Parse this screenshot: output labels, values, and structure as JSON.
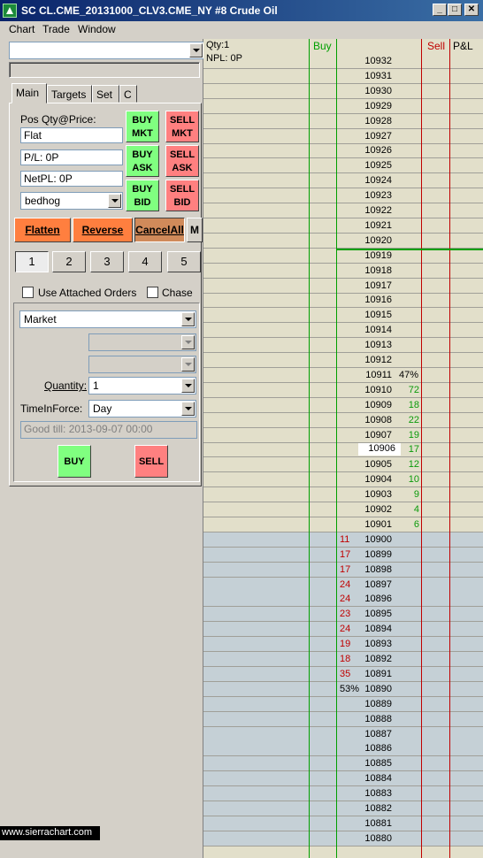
{
  "window": {
    "title": "SC CL.CME_20131000_CLV3.CME_NY  #8  Crude Oil",
    "minimize": "_",
    "maximize": "□",
    "close": "✕"
  },
  "menu": [
    "Chart",
    "Trade",
    "Window"
  ],
  "left": {
    "account_combo": "",
    "tabs": [
      "Main",
      "Targets",
      "Set",
      "C"
    ],
    "pos_label": "Pos Qty@Price:",
    "pos_value": "Flat",
    "pl_value": "P/L: 0P",
    "netpl_value": "NetPL: 0P",
    "account_value": "bedhog",
    "trade_buttons": {
      "buy_mkt": [
        "BUY",
        "MKT"
      ],
      "sell_mkt": [
        "SELL",
        "MKT"
      ],
      "buy_ask": [
        "BUY",
        "ASK"
      ],
      "sell_ask": [
        "SELL",
        "ASK"
      ],
      "buy_bid": [
        "BUY",
        "BID"
      ],
      "sell_bid": [
        "SELL",
        "BID"
      ]
    },
    "flatten": "Flatten",
    "reverse": "Reverse",
    "cancel_all": "CancelAll",
    "m_button": "M",
    "qty_presets": [
      "1",
      "2",
      "3",
      "4",
      "5"
    ],
    "use_attached": "Use Attached Orders",
    "chase": "Chase",
    "order_type": "Market",
    "quantity_label": "Quantity:",
    "quantity_value": "1",
    "tif_label": "TimeInForce:",
    "tif_value": "Day",
    "good_till": "Good till: 2013-09-07 00:00",
    "buy": "BUY",
    "sell": "SELL"
  },
  "ladder": {
    "header": {
      "qty": "Qty:1",
      "npl": "NPL: 0P",
      "buy": "Buy",
      "sell": "Sell",
      "pl": "P&L"
    },
    "colors": {
      "buy": "#00a000",
      "sell": "#c00000",
      "ask_bg": "#e2dfca",
      "bid_bg": "#c5d0d6"
    },
    "current_price": "10906",
    "rows": [
      {
        "price": "10932",
        "ask": "",
        "bid": "",
        "pct": ""
      },
      {
        "price": "10931",
        "ask": "",
        "bid": "",
        "pct": ""
      },
      {
        "price": "10930",
        "ask": "",
        "bid": "",
        "pct": ""
      },
      {
        "price": "10929",
        "ask": "",
        "bid": "",
        "pct": ""
      },
      {
        "price": "10928",
        "ask": "",
        "bid": "",
        "pct": ""
      },
      {
        "price": "10927",
        "ask": "",
        "bid": "",
        "pct": ""
      },
      {
        "price": "10926",
        "ask": "",
        "bid": "",
        "pct": ""
      },
      {
        "price": "10925",
        "ask": "",
        "bid": "",
        "pct": ""
      },
      {
        "price": "10924",
        "ask": "",
        "bid": "",
        "pct": ""
      },
      {
        "price": "10923",
        "ask": "",
        "bid": "",
        "pct": ""
      },
      {
        "price": "10922",
        "ask": "",
        "bid": "",
        "pct": ""
      },
      {
        "price": "10921",
        "ask": "",
        "bid": "",
        "pct": ""
      },
      {
        "price": "10920",
        "ask": "",
        "bid": "",
        "pct": ""
      },
      {
        "price": "10919",
        "ask": "",
        "bid": "",
        "pct": ""
      },
      {
        "price": "10918",
        "ask": "",
        "bid": "",
        "pct": ""
      },
      {
        "price": "10917",
        "ask": "",
        "bid": "",
        "pct": ""
      },
      {
        "price": "10916",
        "ask": "",
        "bid": "",
        "pct": ""
      },
      {
        "price": "10915",
        "ask": "",
        "bid": "",
        "pct": ""
      },
      {
        "price": "10914",
        "ask": "",
        "bid": "",
        "pct": ""
      },
      {
        "price": "10913",
        "ask": "",
        "bid": "",
        "pct": ""
      },
      {
        "price": "10912",
        "ask": "",
        "bid": "",
        "pct": ""
      },
      {
        "price": "10911",
        "ask": "",
        "bid": "",
        "pct": "47%"
      },
      {
        "price": "10910",
        "ask": "72",
        "bid": "",
        "pct": ""
      },
      {
        "price": "10909",
        "ask": "18",
        "bid": "",
        "pct": ""
      },
      {
        "price": "10908",
        "ask": "22",
        "bid": "",
        "pct": ""
      },
      {
        "price": "10907",
        "ask": "19",
        "bid": "",
        "pct": ""
      },
      {
        "price": "10906",
        "ask": "17",
        "bid": "",
        "pct": ""
      },
      {
        "price": "10905",
        "ask": "12",
        "bid": "",
        "pct": ""
      },
      {
        "price": "10904",
        "ask": "10",
        "bid": "",
        "pct": ""
      },
      {
        "price": "10903",
        "ask": "9",
        "bid": "",
        "pct": ""
      },
      {
        "price": "10902",
        "ask": "4",
        "bid": "",
        "pct": ""
      },
      {
        "price": "10901",
        "ask": "6",
        "bid": "",
        "pct": ""
      },
      {
        "price": "10900",
        "ask": "",
        "bid": "11",
        "pct": ""
      },
      {
        "price": "10899",
        "ask": "",
        "bid": "17",
        "pct": ""
      },
      {
        "price": "10898",
        "ask": "",
        "bid": "17",
        "pct": ""
      },
      {
        "price": "10897",
        "ask": "",
        "bid": "24",
        "pct": ""
      },
      {
        "price": "10896",
        "ask": "",
        "bid": "24",
        "pct": ""
      },
      {
        "price": "10895",
        "ask": "",
        "bid": "23",
        "pct": ""
      },
      {
        "price": "10894",
        "ask": "",
        "bid": "24",
        "pct": ""
      },
      {
        "price": "10893",
        "ask": "",
        "bid": "19",
        "pct": ""
      },
      {
        "price": "10892",
        "ask": "",
        "bid": "18",
        "pct": ""
      },
      {
        "price": "10891",
        "ask": "",
        "bid": "35",
        "pct": ""
      },
      {
        "price": "10890",
        "ask": "",
        "bid": "",
        "pct": "53%"
      },
      {
        "price": "10889",
        "ask": "",
        "bid": "",
        "pct": ""
      },
      {
        "price": "10888",
        "ask": "",
        "bid": "",
        "pct": ""
      },
      {
        "price": "10887",
        "ask": "",
        "bid": "",
        "pct": ""
      },
      {
        "price": "10886",
        "ask": "",
        "bid": "",
        "pct": ""
      },
      {
        "price": "10885",
        "ask": "",
        "bid": "",
        "pct": ""
      },
      {
        "price": "10884",
        "ask": "",
        "bid": "",
        "pct": ""
      },
      {
        "price": "10883",
        "ask": "",
        "bid": "",
        "pct": ""
      },
      {
        "price": "10882",
        "ask": "",
        "bid": "",
        "pct": ""
      },
      {
        "price": "10881",
        "ask": "",
        "bid": "",
        "pct": ""
      },
      {
        "price": "10880",
        "ask": "",
        "bid": "",
        "pct": ""
      }
    ]
  },
  "watermark": "www.sierrachart.com"
}
